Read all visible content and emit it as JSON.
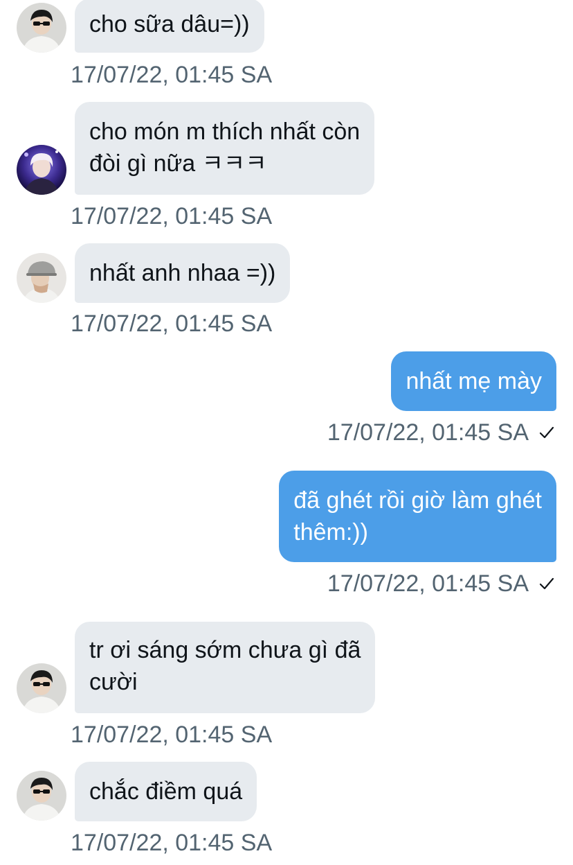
{
  "conversation": {
    "messages": [
      {
        "direction": "in",
        "lines": [
          "cho sữa dâu=))"
        ],
        "time": "17/07/22, 01:45 SA",
        "avatar": "avatar-sunglasses"
      },
      {
        "direction": "in",
        "lines": [
          "cho món m thích nhất còn",
          "đòi gì nữa ㅋㅋㅋ"
        ],
        "time": "17/07/22, 01:45 SA",
        "avatar": "avatar-concert"
      },
      {
        "direction": "in",
        "lines": [
          "nhất anh nhaa =))"
        ],
        "time": "17/07/22, 01:45 SA",
        "avatar": "avatar-cap"
      },
      {
        "direction": "out",
        "lines": [
          "nhất mẹ mày"
        ],
        "time": "17/07/22, 01:45 SA",
        "status": "sent-check-icon"
      },
      {
        "direction": "out",
        "lines": [
          "đã ghét rồi giờ làm ghét",
          "thêm:))"
        ],
        "time": "17/07/22, 01:45 SA",
        "status": "sent-check-icon"
      },
      {
        "direction": "in",
        "lines": [
          "tr ơi sáng sớm chưa gì đã",
          "cười"
        ],
        "time": "17/07/22, 01:45 SA",
        "avatar": "avatar-sunglasses"
      },
      {
        "direction": "in",
        "lines": [
          "chắc điềm quá"
        ],
        "time": "17/07/22, 01:45 SA",
        "avatar": "avatar-sunglasses"
      }
    ]
  },
  "colors": {
    "incoming_bubble": "#e7ebef",
    "outgoing_bubble": "#4c9ee8",
    "timestamp": "#536471"
  }
}
